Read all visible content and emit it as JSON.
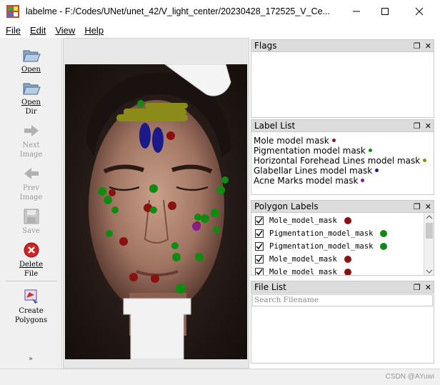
{
  "window": {
    "title": "labelme - F:/Codes/UNet/unet_42/V_light_center/20230428_172525_V_Ce..."
  },
  "menu": [
    "File",
    "Edit",
    "View",
    "Help"
  ],
  "toolbar": {
    "open": {
      "line1": "Open",
      "line2": ""
    },
    "open_dir": {
      "line1": "Open",
      "line2": "Dir"
    },
    "next": {
      "line1": "Next",
      "line2": "Image"
    },
    "prev": {
      "line1": "Prev",
      "line2": "Image"
    },
    "save": {
      "line1": "Save",
      "line2": ""
    },
    "delete": {
      "line1": "Delete",
      "line2": "File"
    },
    "create": {
      "line1": "Create",
      "line2": "Polygons"
    },
    "more": "»"
  },
  "flags": {
    "title": "Flags"
  },
  "label_list": {
    "title": "Label List",
    "items": [
      {
        "text": "Mole model mask",
        "color": "#8b1a1a"
      },
      {
        "text": "Pigmentation model mask",
        "color": "#1a8b1a"
      },
      {
        "text": "Horizontal Forehead Lines model mask",
        "color": "#8b8b1a"
      },
      {
        "text": "Glabellar Lines model mask",
        "color": "#1a1a8b"
      },
      {
        "text": "Acne Marks model mask",
        "color": "#8b1a8b"
      }
    ]
  },
  "polygon_labels": {
    "title": "Polygon Labels",
    "items": [
      {
        "text": "Mole_model_mask",
        "color": "#8b1010"
      },
      {
        "text": "Pigmentation_model_mask",
        "color": "#108b10"
      },
      {
        "text": "Pigmentation_model_mask",
        "color": "#108b10"
      },
      {
        "text": "Mole_model_mask",
        "color": "#8b1010"
      },
      {
        "text": "Mole_model_mask",
        "color": "#8b1010"
      }
    ]
  },
  "file_list": {
    "title": "File List",
    "search_placeholder": "Search Filename"
  },
  "watermark": "CSDN @AYuwi"
}
